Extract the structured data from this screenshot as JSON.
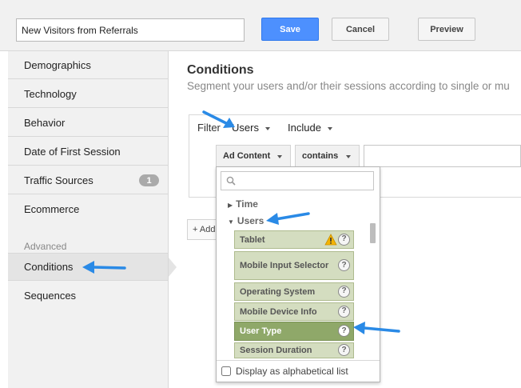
{
  "header": {
    "segment_name": "New Visitors from Referrals",
    "save_label": "Save",
    "cancel_label": "Cancel",
    "preview_label": "Preview"
  },
  "sidebar": {
    "items": [
      {
        "label": "Demographics"
      },
      {
        "label": "Technology"
      },
      {
        "label": "Behavior"
      },
      {
        "label": "Date of First Session"
      },
      {
        "label": "Traffic Sources",
        "badge": "1"
      },
      {
        "label": "Ecommerce"
      }
    ],
    "advanced_label": "Advanced",
    "advanced_items": [
      {
        "label": "Conditions",
        "active": true
      },
      {
        "label": "Sequences"
      }
    ]
  },
  "main": {
    "title": "Conditions",
    "subtitle": "Segment your users and/or their sessions according to single or mu",
    "filter": {
      "label": "Filter",
      "scope": "Users",
      "mode": "Include",
      "dimension": "Ad Content",
      "operator": "contains",
      "value": ""
    },
    "add_label": "+ Add"
  },
  "dropdown": {
    "search_placeholder": "",
    "groups": [
      {
        "label": "Time",
        "expanded": false
      },
      {
        "label": "Users",
        "expanded": true
      }
    ],
    "items": [
      {
        "label": "Tablet",
        "warning": true
      },
      {
        "label": "Mobile Input Selector"
      },
      {
        "label": "Operating System"
      },
      {
        "label": "Mobile Device Info"
      },
      {
        "label": "User Type",
        "highlighted": true
      },
      {
        "label": "Session Duration"
      }
    ],
    "help_glyph": "?",
    "alphabetical_label": "Display as alphabetical list",
    "alphabetical_checked": false
  },
  "colors": {
    "primary_button": "#4d90fe",
    "item_bg": "#d4ddc0",
    "item_highlight": "#8fa869",
    "annotation_arrow": "#2a8ae6"
  }
}
